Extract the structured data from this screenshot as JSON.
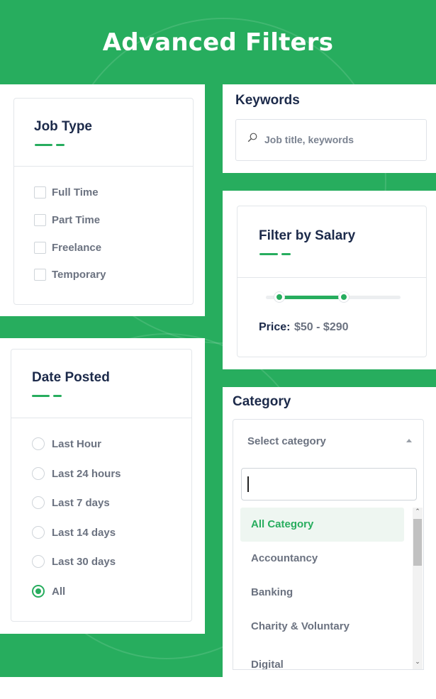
{
  "header": {
    "title": "Advanced Filters"
  },
  "job_type": {
    "title": "Job Type",
    "options": [
      {
        "label": "Full Time",
        "checked": false
      },
      {
        "label": "Part Time",
        "checked": false
      },
      {
        "label": "Freelance",
        "checked": false
      },
      {
        "label": "Temporary",
        "checked": false
      }
    ]
  },
  "keywords": {
    "title": "Keywords",
    "placeholder": "Job title, keywords",
    "icon": "search-icon"
  },
  "salary": {
    "title": "Filter by Salary",
    "price_label": "Price:",
    "price_value": "$50 - $290",
    "range_start_fraction": 0.1,
    "range_end_fraction": 0.58
  },
  "date_posted": {
    "title": "Date Posted",
    "options": [
      {
        "label": "Last Hour",
        "selected": false
      },
      {
        "label": "Last 24 hours",
        "selected": false
      },
      {
        "label": "Last 7 days",
        "selected": false
      },
      {
        "label": "Last 14 days",
        "selected": false
      },
      {
        "label": "Last 30 days",
        "selected": false
      },
      {
        "label": "All",
        "selected": true
      }
    ]
  },
  "category": {
    "title": "Category",
    "select_placeholder": "Select category",
    "search_value": "",
    "items": [
      {
        "label": "All Category",
        "active": true
      },
      {
        "label": "Accountancy",
        "active": false
      },
      {
        "label": "Banking",
        "active": false
      },
      {
        "label": "Charity & Voluntary",
        "active": false
      },
      {
        "label": "Digital",
        "active": false
      }
    ]
  },
  "colors": {
    "accent": "#27ad5e",
    "heading": "#1c2a4a",
    "muted": "#6b7280"
  }
}
